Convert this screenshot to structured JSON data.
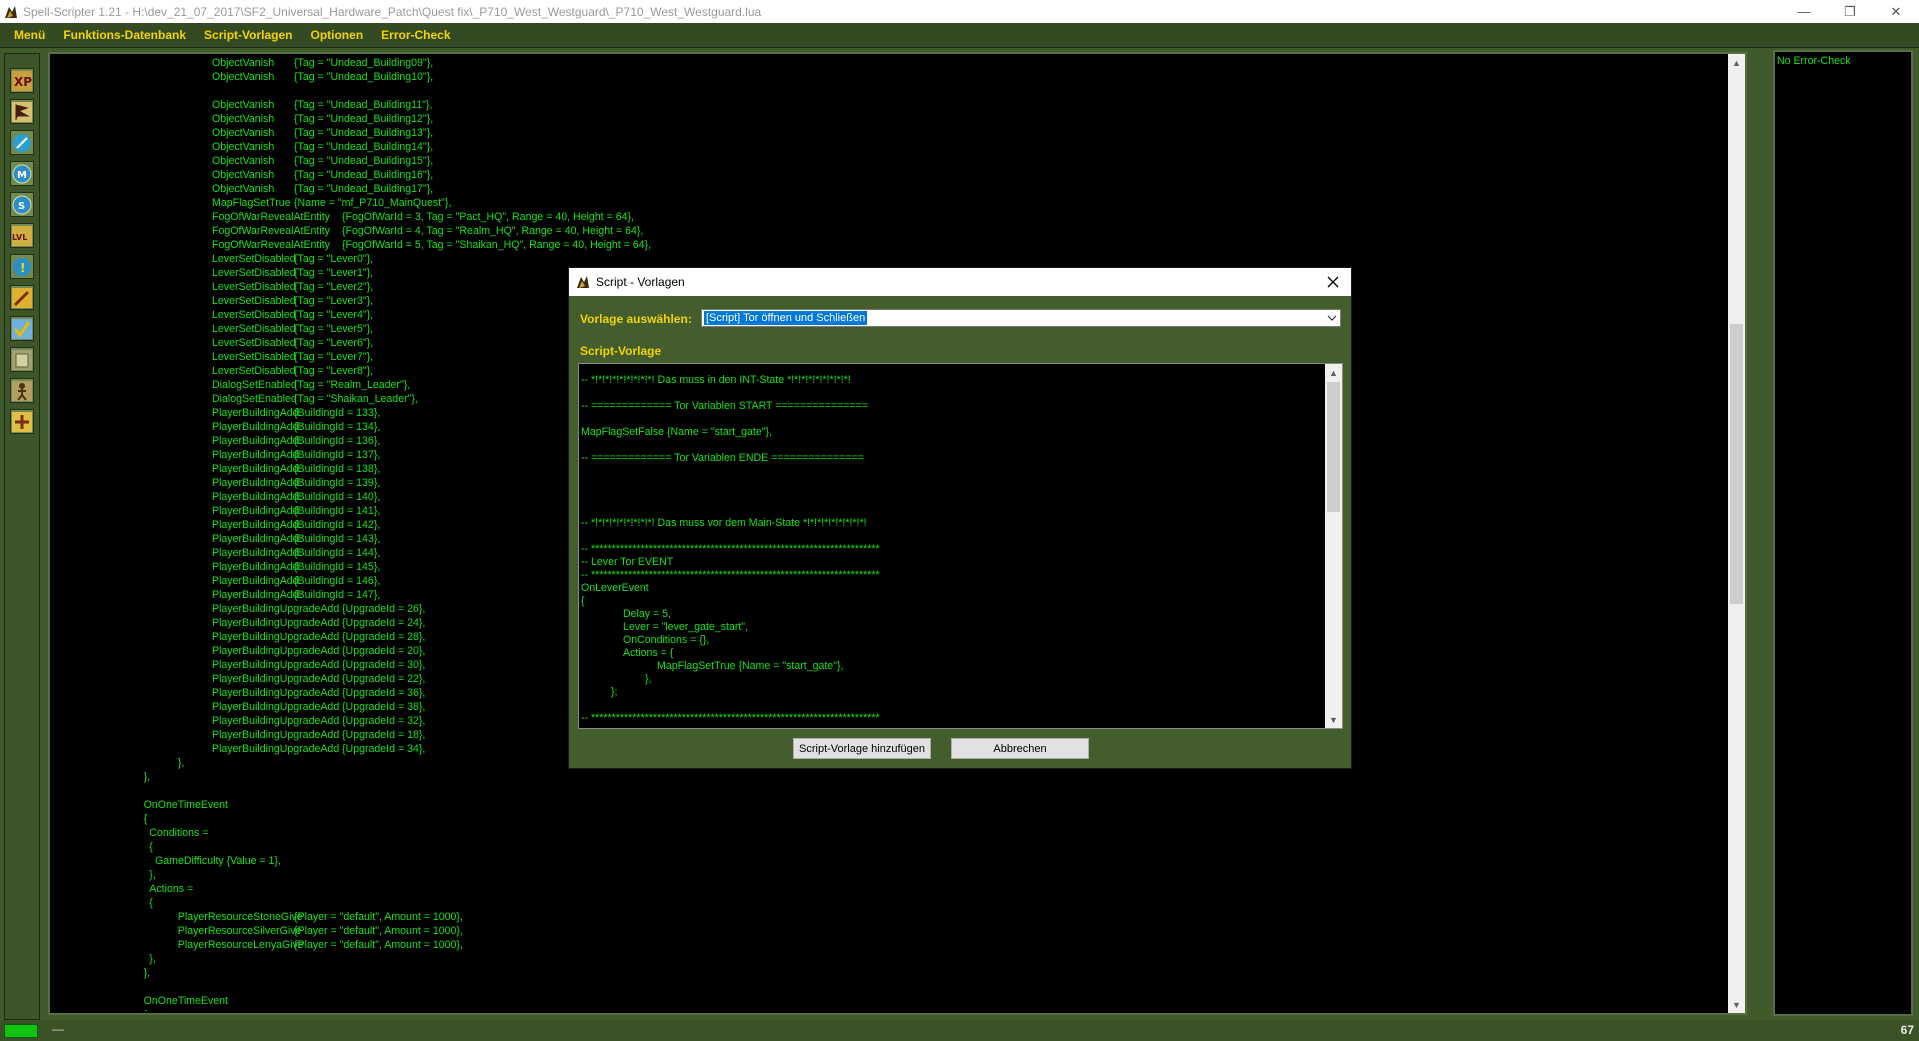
{
  "window": {
    "title": "Spell-Scripter 1.21 - H:\\dev_21_07_2017\\SF2_Universal_Hardware_Patch\\Quest fix\\_P710_West_Westguard\\_P710_West_Westguard.lua",
    "minimize": "—",
    "maximize": "❐",
    "close": "✕"
  },
  "menu": [
    "Menü",
    "Funktions-Datenbank",
    "Script-Vorlagen",
    "Optionen",
    "Error-Check"
  ],
  "toolbar": {
    "buttons": [
      {
        "icon": "xp-icon",
        "text": "XP"
      },
      {
        "icon": "flag-icon",
        "text": ""
      },
      {
        "icon": "spell-icon",
        "text": ""
      },
      {
        "icon": "mana-icon",
        "text": "M"
      },
      {
        "icon": "silver-icon",
        "text": "S"
      },
      {
        "icon": "level-icon",
        "text": "LVL"
      },
      {
        "icon": "info-icon",
        "text": "!"
      },
      {
        "icon": "sword-icon",
        "text": ""
      },
      {
        "icon": "check-icon",
        "text": ""
      },
      {
        "icon": "gate-icon",
        "text": ""
      },
      {
        "icon": "figure-icon",
        "text": ""
      },
      {
        "icon": "add-icon",
        "text": ""
      }
    ]
  },
  "editor": {
    "lines": [
      {
        "i": 20,
        "a": "ObjectVanish",
        "b": "{Tag = \"Undead_Building09\"},"
      },
      {
        "i": 20,
        "a": "ObjectVanish",
        "b": "{Tag = \"Undead_Building10\"},"
      },
      {
        "i": 0,
        "a": "",
        "b": ""
      },
      {
        "i": 20,
        "a": "ObjectVanish",
        "b": "{Tag = \"Undead_Building11\"},"
      },
      {
        "i": 20,
        "a": "ObjectVanish",
        "b": "{Tag = \"Undead_Building12\"},"
      },
      {
        "i": 20,
        "a": "ObjectVanish",
        "b": "{Tag = \"Undead_Building13\"},"
      },
      {
        "i": 20,
        "a": "ObjectVanish",
        "b": "{Tag = \"Undead_Building14\"},"
      },
      {
        "i": 20,
        "a": "ObjectVanish",
        "b": "{Tag = \"Undead_Building15\"},"
      },
      {
        "i": 20,
        "a": "ObjectVanish",
        "b": "{Tag = \"Undead_Building16\"},"
      },
      {
        "i": 20,
        "a": "ObjectVanish",
        "b": "{Tag = \"Undead_Building17\"},"
      },
      {
        "i": 20,
        "a": "MapFlagSetTrue",
        "b": "{Name = \"mf_P710_MainQuest\"},"
      },
      {
        "i": 20,
        "a": "FogOfWarRevealAtEntity",
        "b": "{FogOfWarId = 3, Tag = \"Pact_HQ\", Range = 40, Height = 64},",
        "w": 1
      },
      {
        "i": 20,
        "a": "FogOfWarRevealAtEntity",
        "b": "{FogOfWarId = 4, Tag = \"Realm_HQ\", Range = 40, Height = 64},",
        "w": 1
      },
      {
        "i": 20,
        "a": "FogOfWarRevealAtEntity",
        "b": "{FogOfWarId = 5, Tag = \"Shaikan_HQ\", Range = 40, Height = 64},",
        "w": 1
      },
      {
        "i": 20,
        "a": "LeverSetDisabled",
        "b": "{Tag = \"Lever0\"},"
      },
      {
        "i": 20,
        "a": "LeverSetDisabled",
        "b": "{Tag = \"Lever1\"},"
      },
      {
        "i": 20,
        "a": "LeverSetDisabled",
        "b": "{Tag = \"Lever2\"},"
      },
      {
        "i": 20,
        "a": "LeverSetDisabled",
        "b": "{Tag = \"Lever3\"},"
      },
      {
        "i": 20,
        "a": "LeverSetDisabled",
        "b": "{Tag = \"Lever4\"},"
      },
      {
        "i": 20,
        "a": "LeverSetDisabled",
        "b": "{Tag = \"Lever5\"},"
      },
      {
        "i": 20,
        "a": "LeverSetDisabled",
        "b": "{Tag = \"Lever6\"},"
      },
      {
        "i": 20,
        "a": "LeverSetDisabled",
        "b": "{Tag = \"Lever7\"},"
      },
      {
        "i": 20,
        "a": "LeverSetDisabled",
        "b": "{Tag = \"Lever8\"},"
      },
      {
        "i": 20,
        "a": "DialogSetEnabled",
        "b": "{Tag = \"Realm_Leader\"},"
      },
      {
        "i": 20,
        "a": "DialogSetEnabled",
        "b": "{Tag = \"Shaikan_Leader\"},"
      },
      {
        "i": 20,
        "a": "PlayerBuildingAdd",
        "b": "{BuildingId = 133},"
      },
      {
        "i": 20,
        "a": "PlayerBuildingAdd",
        "b": "{BuildingId = 134},"
      },
      {
        "i": 20,
        "a": "PlayerBuildingAdd",
        "b": "{BuildingId = 136},"
      },
      {
        "i": 20,
        "a": "PlayerBuildingAdd",
        "b": "{BuildingId = 137},"
      },
      {
        "i": 20,
        "a": "PlayerBuildingAdd",
        "b": "{BuildingId = 138},"
      },
      {
        "i": 20,
        "a": "PlayerBuildingAdd",
        "b": "{BuildingId = 139},"
      },
      {
        "i": 20,
        "a": "PlayerBuildingAdd",
        "b": "{BuildingId = 140},"
      },
      {
        "i": 20,
        "a": "PlayerBuildingAdd",
        "b": "{BuildingId = 141},"
      },
      {
        "i": 20,
        "a": "PlayerBuildingAdd",
        "b": "{BuildingId = 142},"
      },
      {
        "i": 20,
        "a": "PlayerBuildingAdd",
        "b": "{BuildingId = 143},"
      },
      {
        "i": 20,
        "a": "PlayerBuildingAdd",
        "b": "{BuildingId = 144},"
      },
      {
        "i": 20,
        "a": "PlayerBuildingAdd",
        "b": "{BuildingId = 145},"
      },
      {
        "i": 20,
        "a": "PlayerBuildingAdd",
        "b": "{BuildingId = 146},"
      },
      {
        "i": 20,
        "a": "PlayerBuildingAdd",
        "b": "{BuildingId = 147},"
      },
      {
        "i": 20,
        "a": "PlayerBuildingUpgradeAdd",
        "b": "{UpgradeId = 26},",
        "w": 1
      },
      {
        "i": 20,
        "a": "PlayerBuildingUpgradeAdd",
        "b": "{UpgradeId = 24},",
        "w": 1
      },
      {
        "i": 20,
        "a": "PlayerBuildingUpgradeAdd",
        "b": "{UpgradeId = 28},",
        "w": 1
      },
      {
        "i": 20,
        "a": "PlayerBuildingUpgradeAdd",
        "b": "{UpgradeId = 20},",
        "w": 1
      },
      {
        "i": 20,
        "a": "PlayerBuildingUpgradeAdd",
        "b": "{UpgradeId = 30},",
        "w": 1
      },
      {
        "i": 20,
        "a": "PlayerBuildingUpgradeAdd",
        "b": "{UpgradeId = 22},",
        "w": 1
      },
      {
        "i": 20,
        "a": "PlayerBuildingUpgradeAdd",
        "b": "{UpgradeId = 36},",
        "w": 1
      },
      {
        "i": 20,
        "a": "PlayerBuildingUpgradeAdd",
        "b": "{UpgradeId = 38},",
        "w": 1
      },
      {
        "i": 20,
        "a": "PlayerBuildingUpgradeAdd",
        "b": "{UpgradeId = 32},",
        "w": 1
      },
      {
        "i": 20,
        "a": "PlayerBuildingUpgradeAdd",
        "b": "{UpgradeId = 18},",
        "w": 1
      },
      {
        "i": 20,
        "a": "PlayerBuildingUpgradeAdd",
        "b": "{UpgradeId = 34},",
        "w": 1
      },
      {
        "i": 14,
        "a": "},",
        "b": ""
      },
      {
        "i": 8,
        "a": "},",
        "b": ""
      },
      {
        "i": 0,
        "a": "",
        "b": ""
      },
      {
        "i": 8,
        "a": "OnOneTimeEvent",
        "b": ""
      },
      {
        "i": 8,
        "a": "{",
        "b": ""
      },
      {
        "i": 9,
        "a": "Conditions =",
        "b": ""
      },
      {
        "i": 9,
        "a": "{",
        "b": ""
      },
      {
        "i": 10,
        "a": "GameDifficulty {Value = 1},",
        "b": ""
      },
      {
        "i": 9,
        "a": "},",
        "b": ""
      },
      {
        "i": 9,
        "a": "Actions =",
        "b": ""
      },
      {
        "i": 9,
        "a": "{",
        "b": ""
      },
      {
        "i": 14,
        "a": "PlayerResourceStoneGive",
        "b": "{Player = \"default\", Amount = 1000},"
      },
      {
        "i": 14,
        "a": "PlayerResourceSilverGive",
        "b": "{Player = \"default\", Amount = 1000},"
      },
      {
        "i": 14,
        "a": "PlayerResourceLenyaGive",
        "b": "{Player = \"default\", Amount = 1000},"
      },
      {
        "i": 9,
        "a": "},",
        "b": ""
      },
      {
        "i": 8,
        "a": "},",
        "b": ""
      },
      {
        "i": 0,
        "a": "",
        "b": ""
      },
      {
        "i": 8,
        "a": "OnOneTimeEvent",
        "b": ""
      },
      {
        "i": 8,
        "a": "{",
        "b": ""
      }
    ]
  },
  "error_panel": {
    "text": "No Error-Check"
  },
  "status": {
    "dash": "—",
    "line_number": "67"
  },
  "dialog": {
    "title": "Script - Vorlagen",
    "select_label": "Vorlage auswählen:",
    "selected": "[Script] Tor öffnen und Schließen",
    "section_label": "Script-Vorlage",
    "lines": [
      {
        "i": 0,
        "t": "-- *!*!*!*!*!*!*!*!*! Das muss in den INT-State *!*!*!*!*!*!*!*!*!"
      },
      {
        "i": 0,
        "t": ""
      },
      {
        "i": 0,
        "t": "-- ============= Tor Variablen START ==============="
      },
      {
        "i": 0,
        "t": ""
      },
      {
        "i": 0,
        "t": "MapFlagSetFalse {Name = \"start_gate\"},"
      },
      {
        "i": 0,
        "t": ""
      },
      {
        "i": 0,
        "t": "-- ============= Tor Variablen ENDE ==============="
      },
      {
        "i": 0,
        "t": ""
      },
      {
        "i": 0,
        "t": ""
      },
      {
        "i": 0,
        "t": ""
      },
      {
        "i": 0,
        "t": ""
      },
      {
        "i": 0,
        "t": "-- *!*!*!*!*!*!*!*!*! Das muss vor dem Main-State *!*!*!*!*!*!*!*!*!"
      },
      {
        "i": 0,
        "t": ""
      },
      {
        "i": 0,
        "t": "-- **********************************************************************"
      },
      {
        "i": 0,
        "t": "-- Lever Tor EVENT"
      },
      {
        "i": 0,
        "t": "-- **********************************************************************"
      },
      {
        "i": 0,
        "t": "OnLeverEvent"
      },
      {
        "i": 0,
        "t": "{"
      },
      {
        "i": 1,
        "t": "Delay = 5,"
      },
      {
        "i": 1,
        "t": "Lever = \"lever_gate_start\","
      },
      {
        "i": 1,
        "t": "OnConditions = {},"
      },
      {
        "i": 1,
        "t": "Actions = {"
      },
      {
        "i": 2,
        "t": "MapFlagSetTrue {Name = \"start_gate\"},"
      },
      {
        "i": 3,
        "t": "},"
      },
      {
        "i": 4,
        "t": "};"
      },
      {
        "i": 0,
        "t": ""
      },
      {
        "i": 0,
        "t": "-- **********************************************************************"
      }
    ],
    "add_button": "Script-Vorlage hinzufügen",
    "cancel_button": "Abbrechen"
  },
  "colors": {
    "code_green": "#19e019",
    "menu_yellow": "#f1d400",
    "frame_green": "#3f5a2b"
  }
}
